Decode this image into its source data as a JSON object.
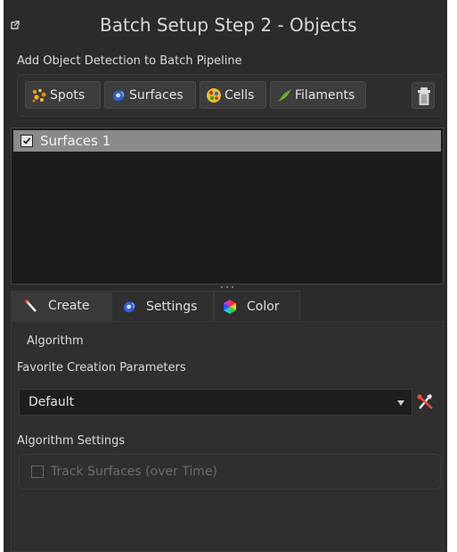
{
  "header": {
    "title": "Batch Setup Step 2 - Objects",
    "popout_icon": "popout-icon"
  },
  "add_section": {
    "label": "Add Object Detection to Batch Pipeline",
    "buttons": [
      {
        "label": "Spots",
        "icon": "spots-icon"
      },
      {
        "label": "Surfaces",
        "icon": "surfaces-icon"
      },
      {
        "label": "Cells",
        "icon": "cells-icon"
      },
      {
        "label": "Filaments",
        "icon": "filaments-icon"
      }
    ],
    "delete_icon": "trash-icon"
  },
  "objects_list": {
    "items": [
      {
        "label": "Surfaces 1",
        "checked": true,
        "selected": true
      }
    ]
  },
  "tabs": [
    {
      "label": "Create",
      "icon": "wand-icon",
      "active": true
    },
    {
      "label": "Settings",
      "icon": "surfaces-icon",
      "active": false
    },
    {
      "label": "Color",
      "icon": "color-wheel-icon",
      "active": false
    }
  ],
  "create_panel": {
    "algorithm_label": "Algorithm",
    "favorite_label": "Favorite Creation Parameters",
    "favorite_value": "Default",
    "algorithm_settings_label": "Algorithm Settings",
    "track_label": "Track Surfaces (over Time)",
    "track_checked": false,
    "track_enabled": false
  }
}
